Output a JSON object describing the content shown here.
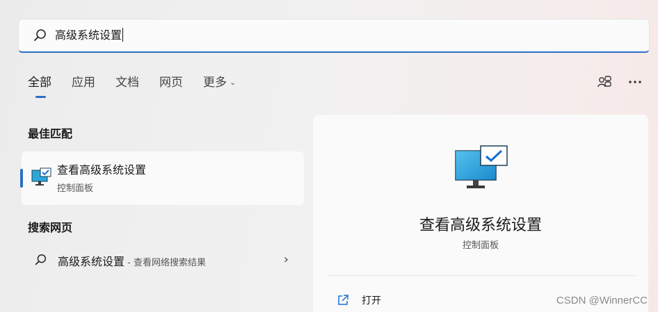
{
  "search": {
    "query": "高级系统设置"
  },
  "tabs": [
    {
      "label": "全部",
      "active": true
    },
    {
      "label": "应用"
    },
    {
      "label": "文档"
    },
    {
      "label": "网页"
    },
    {
      "label": "更多",
      "dropdown": true
    }
  ],
  "top_icons": [
    "share-icon",
    "more-icon"
  ],
  "best_match": {
    "section_title": "最佳匹配",
    "name": "查看高级系统设置",
    "subtitle": "控制面板",
    "icon": "monitor-check-icon"
  },
  "web_search": {
    "section_title": "搜索网页",
    "query": "高级系统设置",
    "hint": " - 查看网络搜索结果"
  },
  "detail": {
    "title": "查看高级系统设置",
    "subtitle": "控制面板",
    "actions": [
      {
        "label": "打开",
        "icon": "open-external-icon"
      }
    ]
  },
  "watermark": "CSDN @WinnerCC",
  "colors": {
    "accent": "#2a6fc4"
  }
}
